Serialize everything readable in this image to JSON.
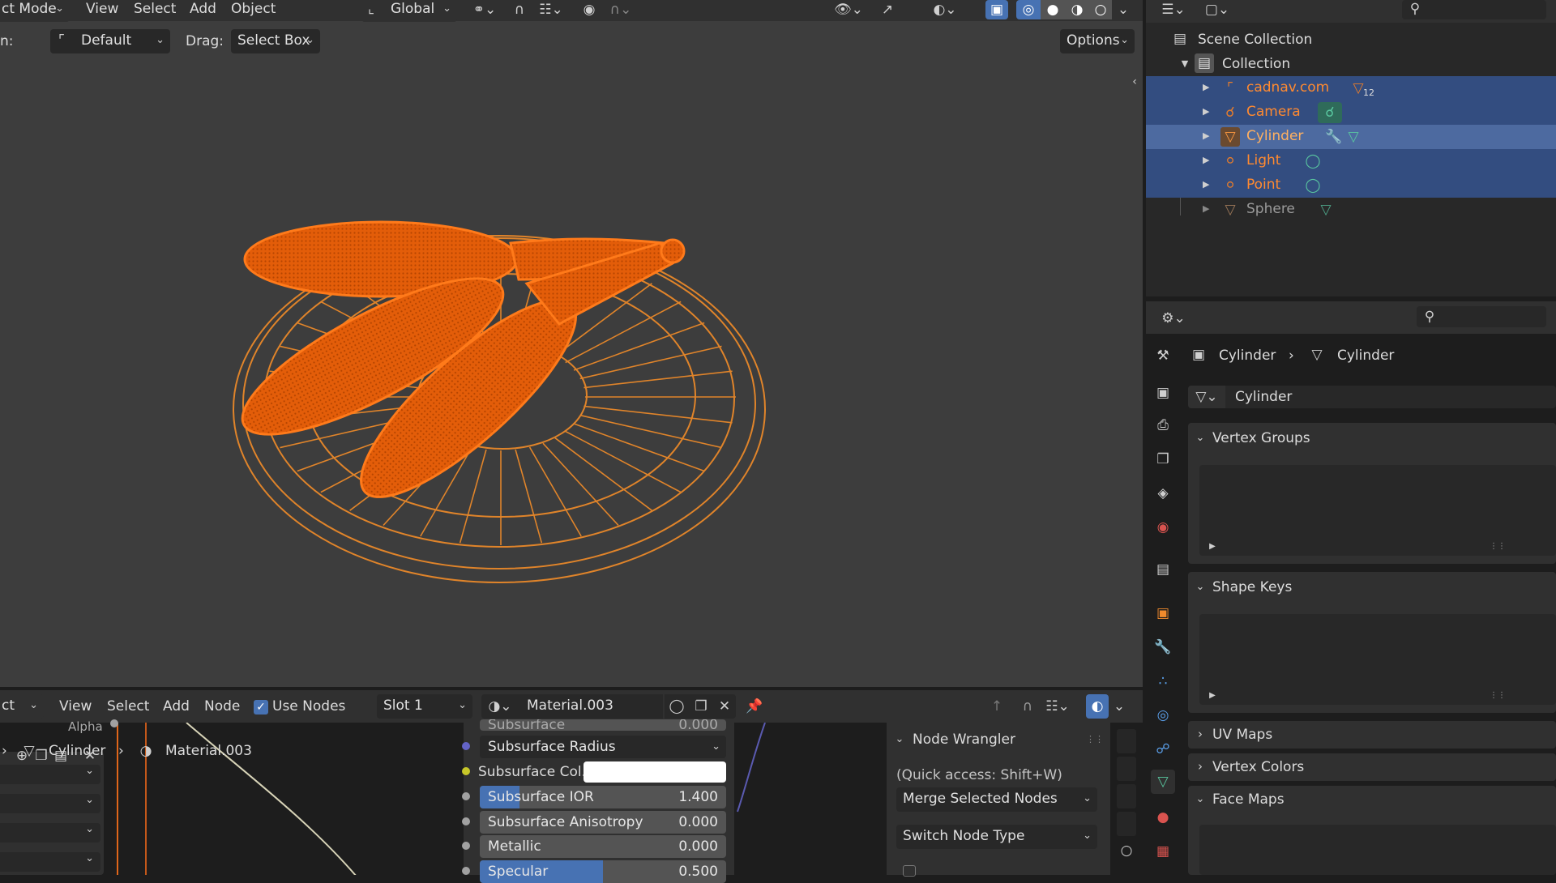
{
  "top_header": {
    "mode": "ct Mode",
    "menus": [
      "View",
      "Select",
      "Add",
      "Object"
    ],
    "orientation": "Global"
  },
  "tool_header": {
    "orientation_label": "n:",
    "orientation_value": "Default",
    "drag_label": "Drag:",
    "drag_value": "Select Box",
    "options": "Options"
  },
  "outliner": {
    "scene_collection": "Scene Collection",
    "collection": "Collection",
    "items": [
      {
        "name": "cadnav.com",
        "badge": "12",
        "selected": true
      },
      {
        "name": "Camera",
        "selected": true
      },
      {
        "name": "Cylinder",
        "selected": true,
        "active": true
      },
      {
        "name": "Light",
        "selected": true
      },
      {
        "name": "Point",
        "selected": true
      },
      {
        "name": "Sphere",
        "selected": false
      }
    ]
  },
  "properties": {
    "breadcrumb_object": "Cylinder",
    "breadcrumb_data": "Cylinder",
    "mesh_name": "Cylinder",
    "panels": {
      "vertex_groups": "Vertex Groups",
      "shape_keys": "Shape Keys",
      "uv_maps": "UV Maps",
      "vertex_colors": "Vertex Colors",
      "face_maps": "Face Maps"
    }
  },
  "node_editor": {
    "editor_type": "ct",
    "menus": [
      "View",
      "Select",
      "Add",
      "Node"
    ],
    "use_nodes": "Use Nodes",
    "slot": "Slot 1",
    "material": "Material.003",
    "breadcrumb_object": "Cylinder",
    "breadcrumb_material": "Material.003",
    "alpha_label": "Alpha",
    "subsurface_label": "Subsurface",
    "subsurface_value": "0.000",
    "subsurface_radius": "Subsurface Radius",
    "subsurface_color_label": "Subsurface Col..",
    "fields": [
      {
        "label": "Subsurface IOR",
        "value": "1.400",
        "fill": 0.15
      },
      {
        "label": "Subsurface Anisotropy",
        "value": "0.000",
        "fill": 0
      },
      {
        "label": "Metallic",
        "value": "0.000",
        "fill": 0
      },
      {
        "label": "Specular",
        "value": "0.500",
        "fill": 0.5
      }
    ]
  },
  "node_wrangler": {
    "title": "Node Wrangler",
    "hint": "(Quick access: Shift+W)",
    "merge": "Merge Selected Nodes",
    "switch": "Switch Node Type"
  },
  "colors": {
    "accent": "#4772b3",
    "selected_object": "#ff7a1a",
    "outliner_selected": "#334d80",
    "wire": "#e88a2c"
  }
}
